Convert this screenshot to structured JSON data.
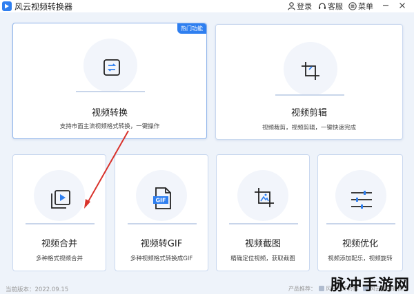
{
  "app": {
    "title": "风云视频转换器"
  },
  "toolbar": {
    "login": "登录",
    "service": "客服",
    "menu": "菜单"
  },
  "cards": {
    "convert": {
      "badge": "热门功能",
      "title": "视频转换",
      "desc": "支持市面主流视频格式转换，一键操作"
    },
    "edit": {
      "title": "视频剪辑",
      "desc": "视频裁剪，视频剪辑，一键快速完成"
    },
    "merge": {
      "title": "视频合并",
      "desc": "多种格式视频合并"
    },
    "gif": {
      "title": "视频转GIF",
      "desc": "多种视频格式转换成GIF",
      "icon_text": "GIF"
    },
    "screenshot": {
      "title": "视频截图",
      "desc": "精确定位视频，获取截图"
    },
    "optimize": {
      "title": "视频优化",
      "desc": "视频添加配乐，视频旋转"
    }
  },
  "footer": {
    "version": "当前版本：2022.09.15",
    "recommend_label": "产品推荐：",
    "app1": "风云PDF转换",
    "app2": "风云视频转换"
  },
  "watermark": "脉冲手游网",
  "colors": {
    "accent": "#2f7ff0",
    "arrow": "#d9322b"
  }
}
